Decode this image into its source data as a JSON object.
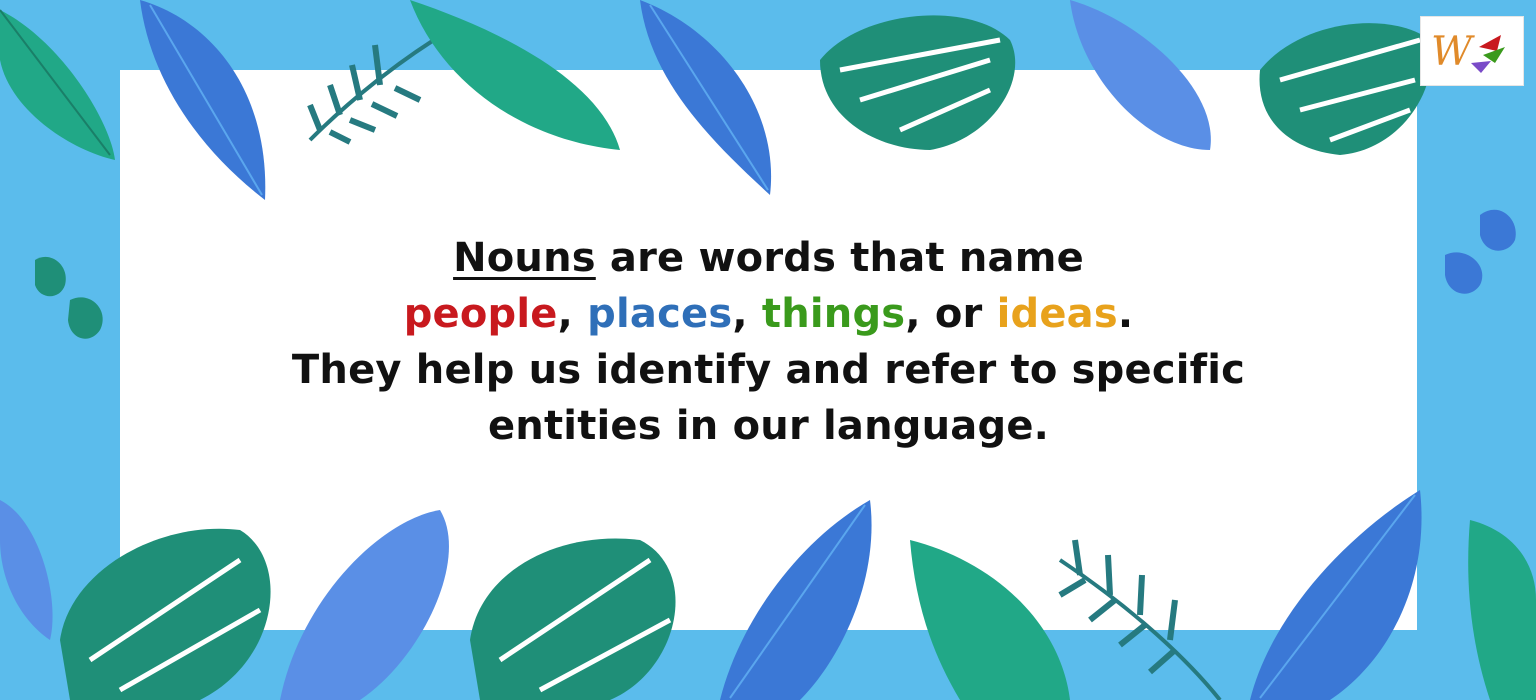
{
  "colors": {
    "background": "#5bbcec",
    "card": "#ffffff",
    "text": "#111111",
    "people": "#c8191e",
    "places": "#2f6fb8",
    "things": "#3a9a1c",
    "ideas": "#e8a21c",
    "leaf_teal": "#1f8f78",
    "leaf_green": "#21a887",
    "leaf_blue": "#3b78d6",
    "leaf_light_blue": "#5a8fe6",
    "leaf_dark": "#267a80"
  },
  "content": {
    "line1_word": "Nouns",
    "line1_rest": " are words that name",
    "people": "people",
    "sep1": ", ",
    "places": "places",
    "sep2": ", ",
    "things": "things",
    "sep3": ", or ",
    "ideas": "ideas",
    "period": ".",
    "line3": "They help us identify and refer to specific",
    "line4": "entities in our language."
  },
  "logo": {
    "letter": "W",
    "icon": "brand-logo-icon"
  }
}
